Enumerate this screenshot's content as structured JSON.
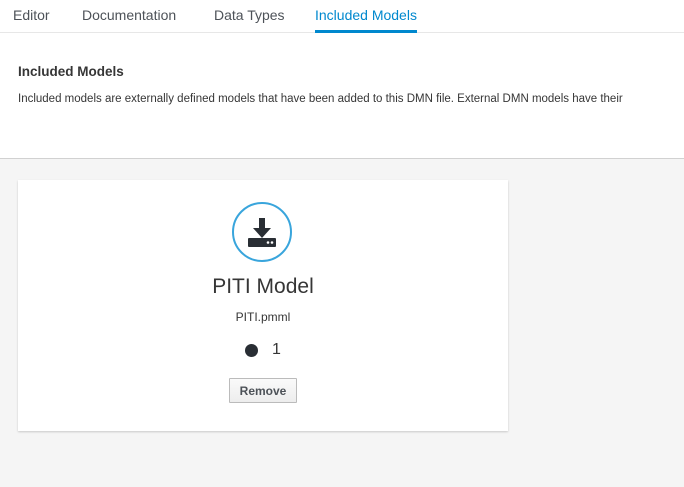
{
  "tabs": [
    {
      "label": "Editor",
      "active": false
    },
    {
      "label": "Documentation",
      "active": false
    },
    {
      "label": "Data Types",
      "active": false
    },
    {
      "label": "Included Models",
      "active": true
    }
  ],
  "header": {
    "title": "Included Models",
    "description": "Included models are externally defined models that have been added to this DMN file. External DMN models have their"
  },
  "card": {
    "icon": "download-icon",
    "title": "PITI Model",
    "file": "PITI.pmml",
    "count": "1",
    "remove_label": "Remove"
  },
  "colors": {
    "accent": "#0088ce",
    "icon_border": "#39a5dc",
    "background": "#f5f5f5"
  }
}
